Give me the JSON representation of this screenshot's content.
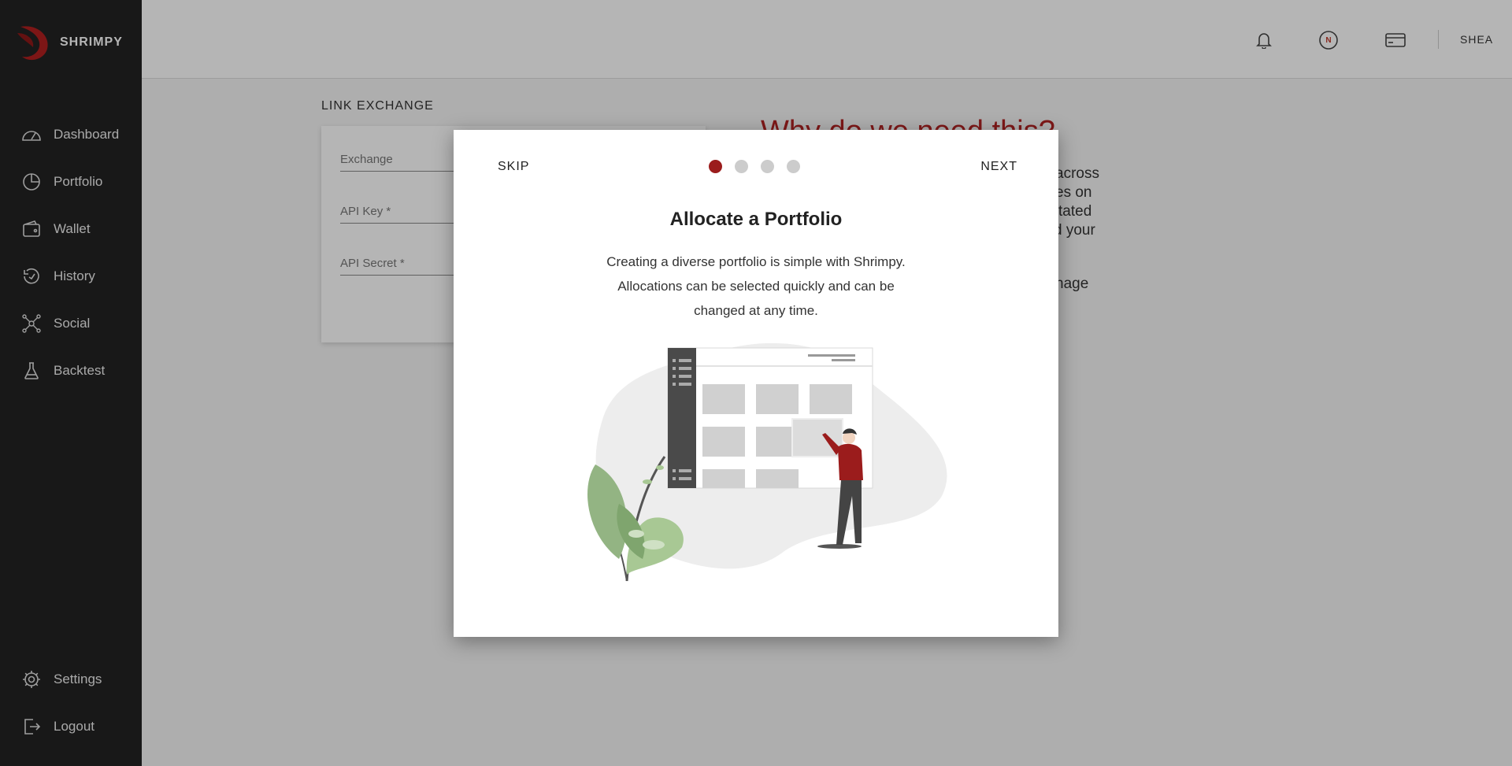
{
  "app": {
    "brand": "SHRIMPY"
  },
  "sidebar": {
    "items": [
      {
        "label": "Dashboard",
        "icon": "dashboard-gauge-icon"
      },
      {
        "label": "Portfolio",
        "icon": "pie-chart-icon"
      },
      {
        "label": "Wallet",
        "icon": "wallet-icon"
      },
      {
        "label": "History",
        "icon": "history-icon"
      },
      {
        "label": "Social",
        "icon": "social-network-icon"
      },
      {
        "label": "Backtest",
        "icon": "flask-icon"
      }
    ],
    "bottom_items": [
      {
        "label": "Settings",
        "icon": "gear-icon"
      },
      {
        "label": "Logout",
        "icon": "logout-icon"
      }
    ]
  },
  "topbar": {
    "icons": [
      "bell-icon",
      "n-badge-icon",
      "card-icon"
    ],
    "badge_letter": "N",
    "user": "SHEA"
  },
  "page": {
    "section_title": "LINK EXCHANGE",
    "form": {
      "exchange_placeholder": "Exchange",
      "api_key_placeholder": "API Key *",
      "api_secret_placeholder": "API Secret *"
    },
    "why_title": "Why do we need this?",
    "why_fragments": [
      "across",
      "es on",
      "tated",
      "d your",
      "nage"
    ]
  },
  "modal": {
    "skip_label": "SKIP",
    "next_label": "NEXT",
    "step_count": 4,
    "active_step": 1,
    "title": "Allocate a Portfolio",
    "body_lines": [
      "Creating a diverse portfolio is simple with Shrimpy.",
      "Allocations can be selected quickly and can be",
      "changed at any time."
    ]
  },
  "colors": {
    "accent": "#9b1c1c",
    "sidebar_bg": "#222222",
    "why_title": "#b22222"
  }
}
